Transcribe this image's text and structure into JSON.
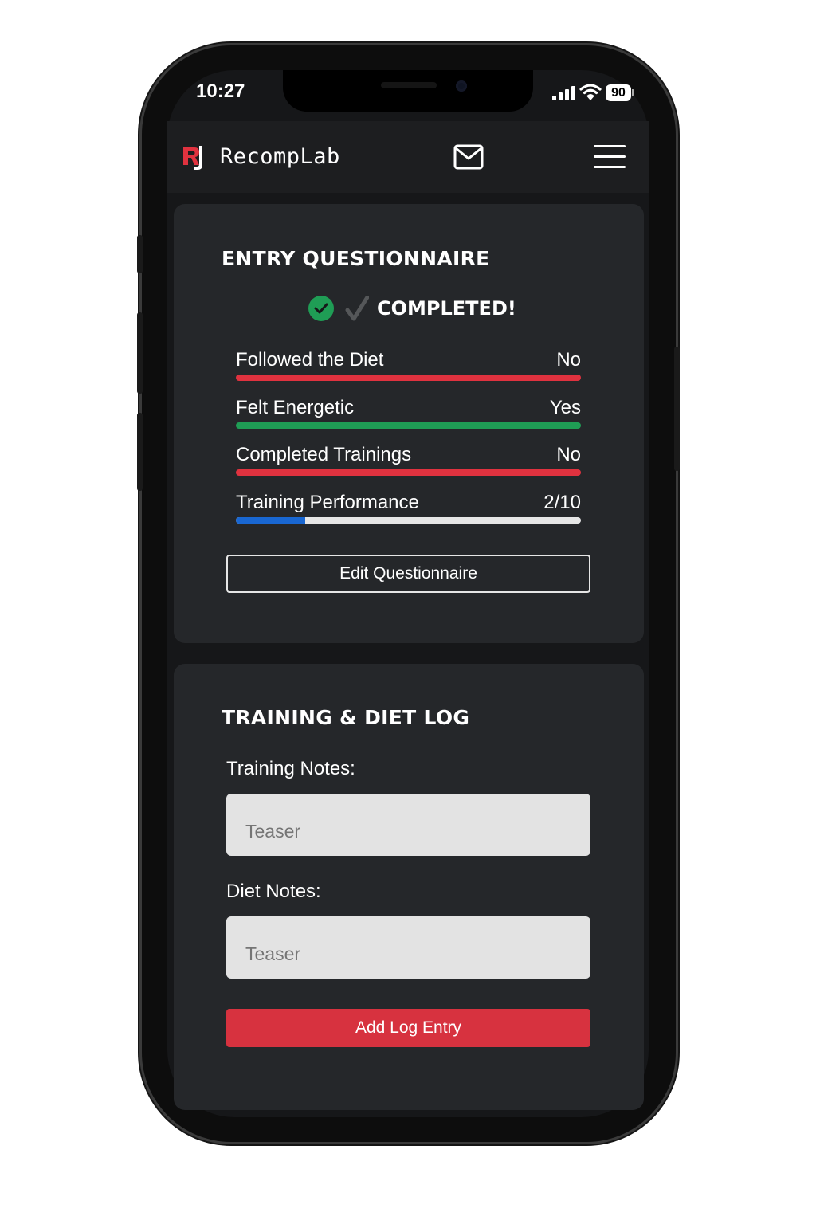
{
  "status_bar": {
    "time": "10:27",
    "battery": "90"
  },
  "navbar": {
    "brand": "RecompLab"
  },
  "questionnaire": {
    "title": "ENTRY QUESTIONNAIRE",
    "status": "COMPLETED!",
    "items": [
      {
        "label": "Followed the Diet",
        "value": "No",
        "bar_color": "#e0323f"
      },
      {
        "label": "Felt Energetic",
        "value": "Yes",
        "bar_color": "#1f9d55"
      },
      {
        "label": "Completed Trainings",
        "value": "No",
        "bar_color": "#e0323f"
      },
      {
        "label": "Training Performance",
        "value": "2/10",
        "progress": 0.2,
        "fill_color": "#1967d2",
        "track_color": "#e6e6e6"
      }
    ],
    "edit_label": "Edit Questionnaire"
  },
  "log": {
    "title": "TRAINING & DIET LOG",
    "training_label": "Training Notes:",
    "training_placeholder": "Teaser",
    "diet_label": "Diet Notes:",
    "diet_placeholder": "Teaser",
    "add_label": "Add Log Entry"
  }
}
